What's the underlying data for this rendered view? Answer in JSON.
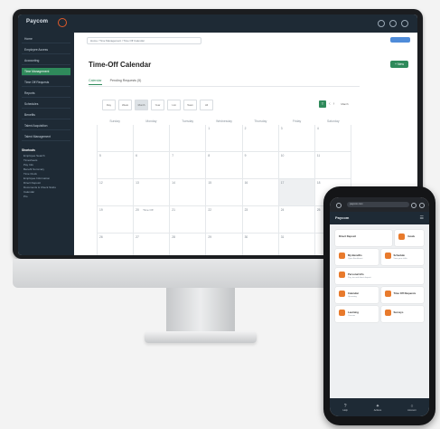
{
  "desktop": {
    "brand": "Paycom",
    "breadcrumb": "Home / Time Management / Time Off Calendar",
    "page_title": "Time-Off Calendar",
    "new_button": "+ New",
    "tabs": [
      "Calendar",
      "Pending Requests (5)"
    ],
    "view_buttons": [
      "Day",
      "Week",
      "Month",
      "Year",
      "List",
      "Team",
      "All"
    ],
    "today_button": "T",
    "month_label": "March",
    "weekdays": [
      "Sunday",
      "Monday",
      "Tuesday",
      "Wednesday",
      "Thursday",
      "Friday",
      "Saturday"
    ],
    "weeks": [
      [
        "",
        "",
        "",
        "1",
        "2",
        "3",
        "4"
      ],
      [
        "5",
        "6",
        "7",
        "8",
        "9",
        "10",
        "11"
      ],
      [
        "12",
        "13",
        "14",
        "15",
        "16",
        "17",
        "18"
      ],
      [
        "19",
        "20",
        "21",
        "22",
        "23",
        "24",
        "25"
      ],
      [
        "26",
        "27",
        "28",
        "29",
        "30",
        "31",
        ""
      ]
    ],
    "events": {
      "w3d1": "Time Off"
    },
    "sidebar": {
      "items": [
        "Home",
        "Employee Access",
        "Accounting",
        "Time Management",
        "Time Off Requests",
        "Reports",
        "Schedules",
        "Benefits",
        "Talent Acquisition",
        "Talent Management"
      ],
      "section_title": "Shortcuts",
      "shortcuts": [
        "Employee Search",
        "Timesheets",
        "Pay Info",
        "Benefit Summary",
        "Time Clock",
        "Employee Information",
        "Direct Deposit",
        "Documents & Check Stubs",
        "Calendar",
        "Pto"
      ]
    }
  },
  "mobile": {
    "url": "paycom.com",
    "brand": "Paycom",
    "menu_icon": "hamburger-icon",
    "cards": [
      {
        "label": "Direct Deposit",
        "sub": ""
      },
      {
        "label": "Goals",
        "sub": ""
      },
      {
        "label": "My Benefits",
        "sub": "Open Enrollment"
      },
      {
        "label": "Schedule",
        "sub": "View your shifts"
      },
      {
        "label": "Personal Info",
        "sub": "Pay, tax and direct deposit"
      },
      {
        "label": "Calendar",
        "sub": "Upcoming"
      },
      {
        "label": "Time Off Requests",
        "sub": ""
      },
      {
        "label": "Learning",
        "sub": "Courses"
      },
      {
        "label": "Surveys",
        "sub": ""
      }
    ],
    "tabbar": [
      "Help",
      "Actions",
      "Account"
    ]
  },
  "colors": {
    "accent": "#2f8a5b",
    "brand_orange": "#e87a2c",
    "nav_dark": "#1e2a35"
  }
}
